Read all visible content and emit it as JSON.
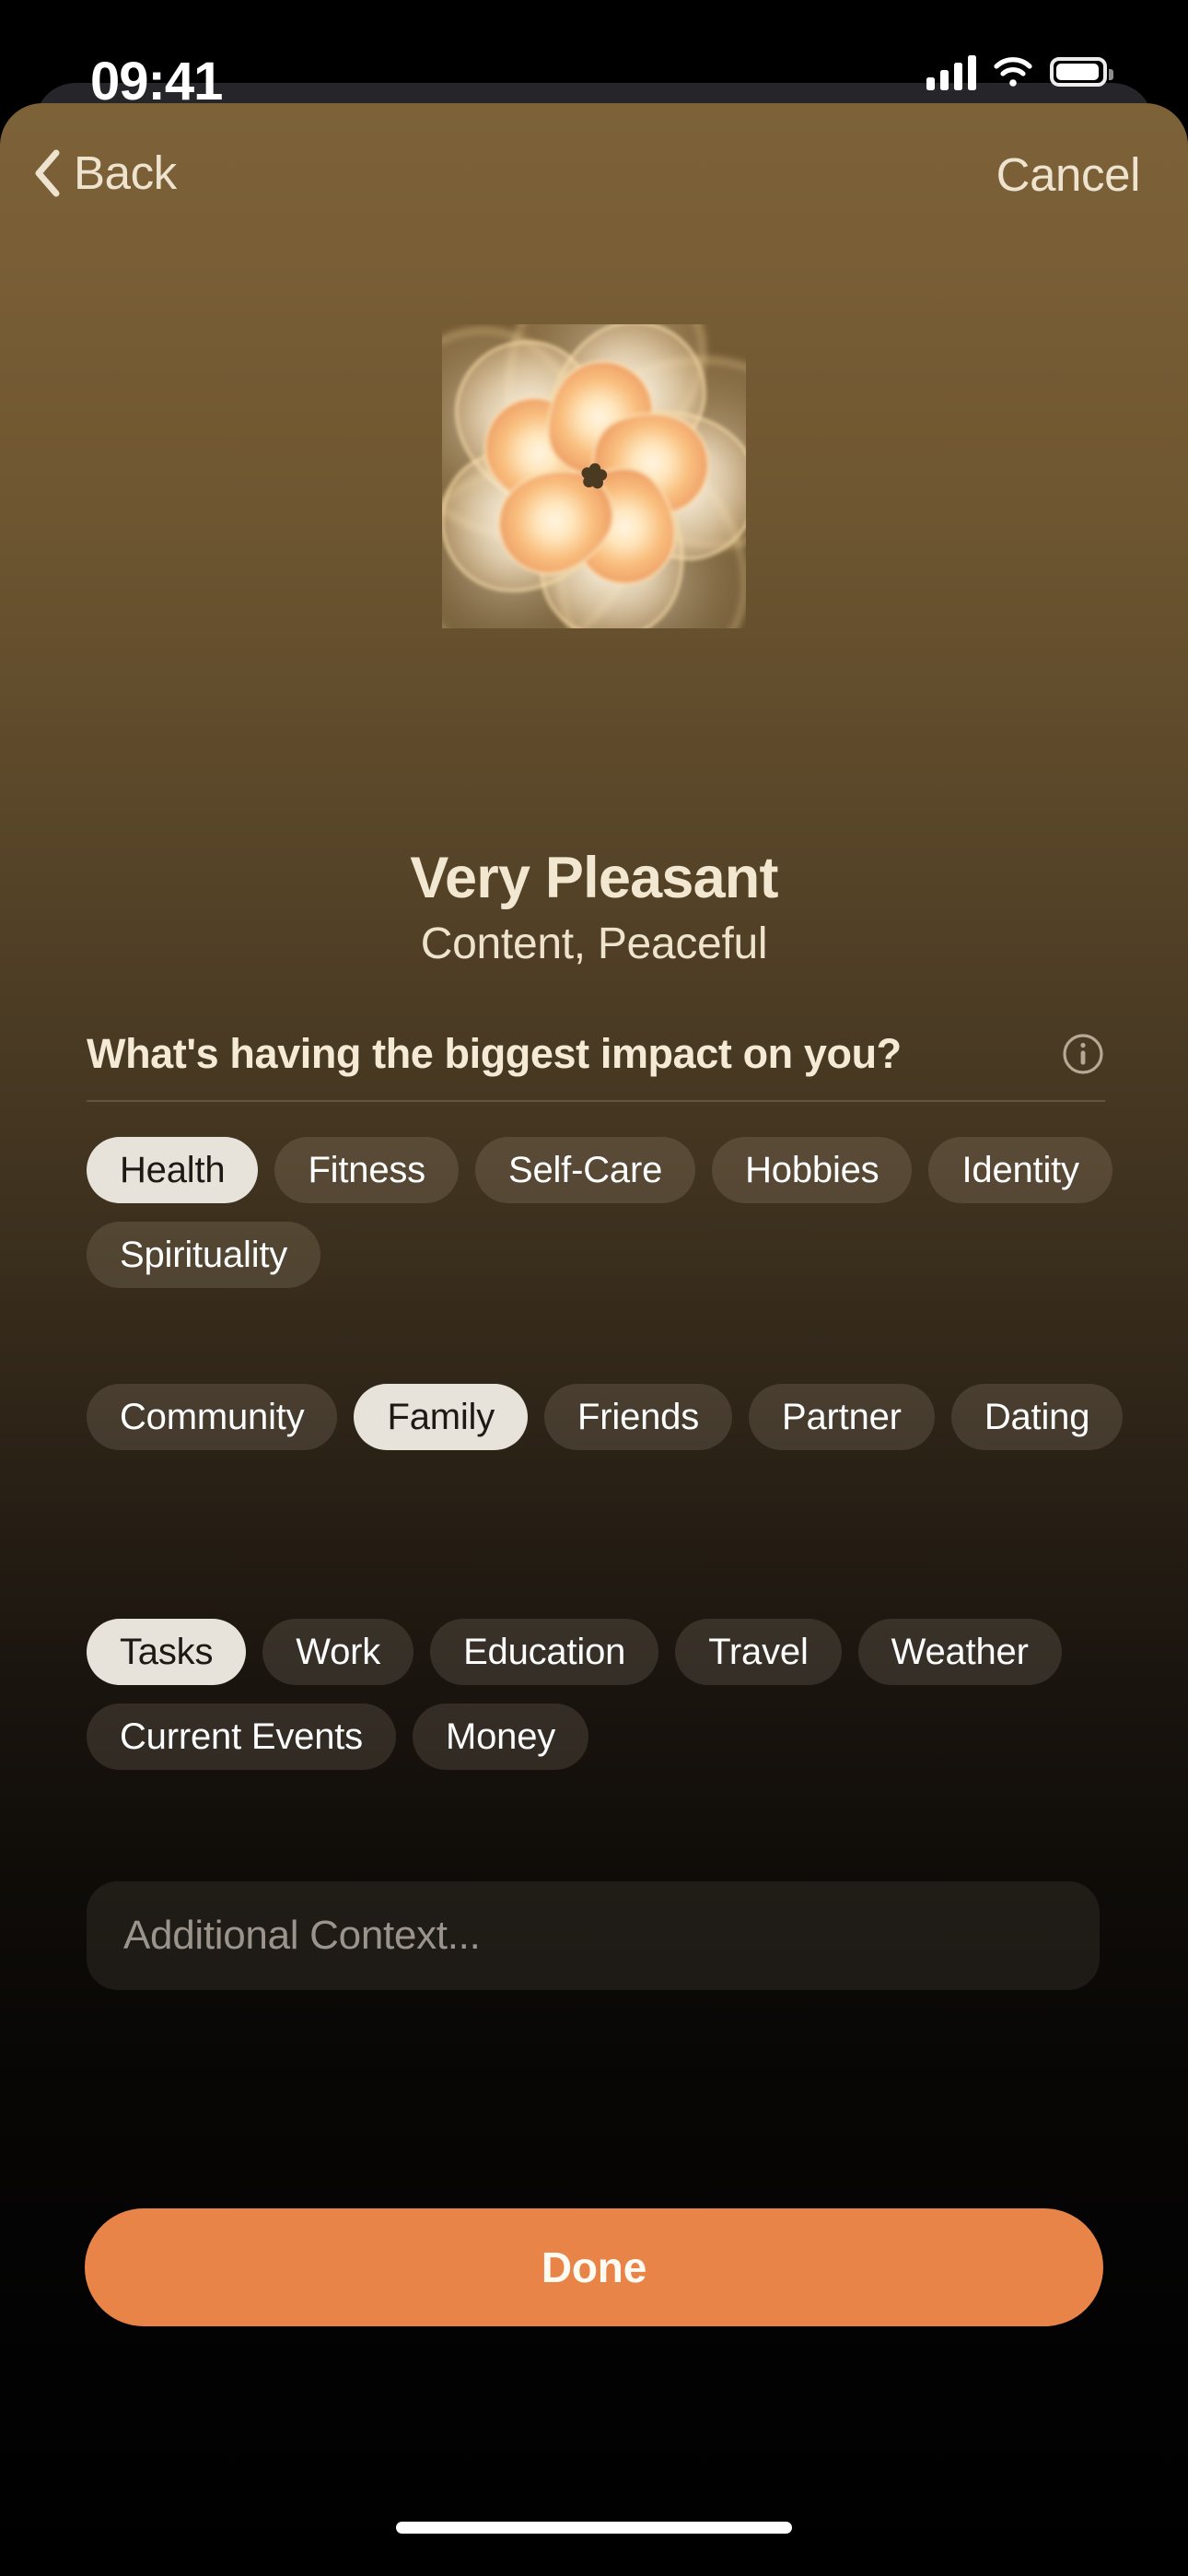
{
  "status_bar": {
    "time": "09:41",
    "cellular_icon": "cellular-bars-icon",
    "wifi_icon": "wifi-icon",
    "battery_icon": "battery-icon"
  },
  "nav": {
    "back_label": "Back",
    "back_icon": "chevron-left-icon",
    "cancel_label": "Cancel"
  },
  "mood": {
    "icon": "flower-icon",
    "title": "Very Pleasant",
    "subtitle": "Content, Peaceful"
  },
  "question": {
    "text": "What's having the biggest impact on you?",
    "info_icon": "info-circle-icon"
  },
  "chip_groups": [
    {
      "name": "personal",
      "chips": [
        {
          "label": "Health",
          "selected": true
        },
        {
          "label": "Fitness",
          "selected": false
        },
        {
          "label": "Self-Care",
          "selected": false
        },
        {
          "label": "Hobbies",
          "selected": false
        },
        {
          "label": "Identity",
          "selected": false
        },
        {
          "label": "Spirituality",
          "selected": false
        }
      ]
    },
    {
      "name": "social",
      "chips": [
        {
          "label": "Community",
          "selected": false
        },
        {
          "label": "Family",
          "selected": true
        },
        {
          "label": "Friends",
          "selected": false
        },
        {
          "label": "Partner",
          "selected": false
        },
        {
          "label": "Dating",
          "selected": false
        }
      ]
    },
    {
      "name": "life",
      "chips": [
        {
          "label": "Tasks",
          "selected": true
        },
        {
          "label": "Work",
          "selected": false
        },
        {
          "label": "Education",
          "selected": false
        },
        {
          "label": "Travel",
          "selected": false
        },
        {
          "label": "Weather",
          "selected": false
        },
        {
          "label": "Current Events",
          "selected": false
        },
        {
          "label": "Money",
          "selected": false
        }
      ]
    }
  ],
  "context_field": {
    "placeholder": "Additional Context...",
    "value": ""
  },
  "done_button": {
    "label": "Done"
  },
  "colors": {
    "sheet_top": "#7d6238",
    "sheet_bottom": "#000000",
    "accent_orange": "#e98448",
    "chip_selected_bg": "#e7e3da",
    "chip_selected_text": "#1d1a15",
    "chip_unselected_text": "#ffffff",
    "title_text": "#f2e7d1",
    "nav_text": "#ede3cf",
    "placeholder_text": "#9a948c"
  }
}
